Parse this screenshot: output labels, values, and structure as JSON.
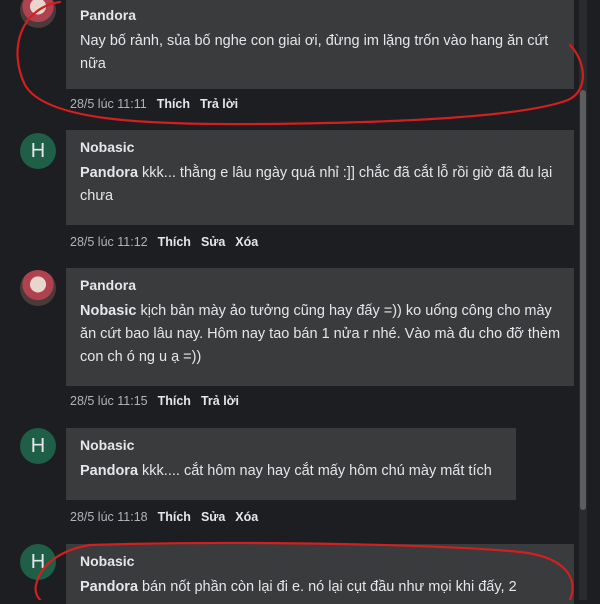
{
  "comments": [
    {
      "author": "Pandora",
      "mention": "",
      "text": "Nay bố rảnh, sủa bố nghe con giai ơi, đừng im lặng trốn vào hang ăn cứt nữa",
      "time": "28/5 lúc 11:11",
      "actions": [
        "Thích",
        "Trả lời"
      ],
      "avatar": "photo"
    },
    {
      "author": "Nobasic",
      "mention": "Pandora",
      "text": "kkk... thằng e lâu ngày quá nhỉ :]] chắc đã cắt lỗ rồi giờ đã đu lại chưa",
      "time": "28/5 lúc 11:12",
      "actions": [
        "Thích",
        "Sửa",
        "Xóa"
      ],
      "avatar": "H"
    },
    {
      "author": "Pandora",
      "mention": "Nobasic",
      "text": "kịch bản mày ảo tưởng cũng hay đấy =)) ko uổng công cho mày ăn cứt bao lâu nay. Hôm nay tao bán 1 nửa r nhé. Vào mà đu cho đỡ thèm con ch ó ng u ạ =))",
      "time": "28/5 lúc 11:15",
      "actions": [
        "Thích",
        "Trả lời"
      ],
      "avatar": "photo"
    },
    {
      "author": "Nobasic",
      "mention": "Pandora",
      "text": "kkk.... cắt hôm nay hay cắt mấy hôm chú mày mất tích",
      "time": "28/5 lúc 11:18",
      "actions": [
        "Thích",
        "Sửa",
        "Xóa"
      ],
      "avatar": "H"
    },
    {
      "author": "Nobasic",
      "mention": "Pandora",
      "text": "bán nốt phần còn lại đi e. nó lại cụt đầu như mọi khi đấy, 2",
      "time": "",
      "actions": [],
      "avatar": "H"
    }
  ]
}
